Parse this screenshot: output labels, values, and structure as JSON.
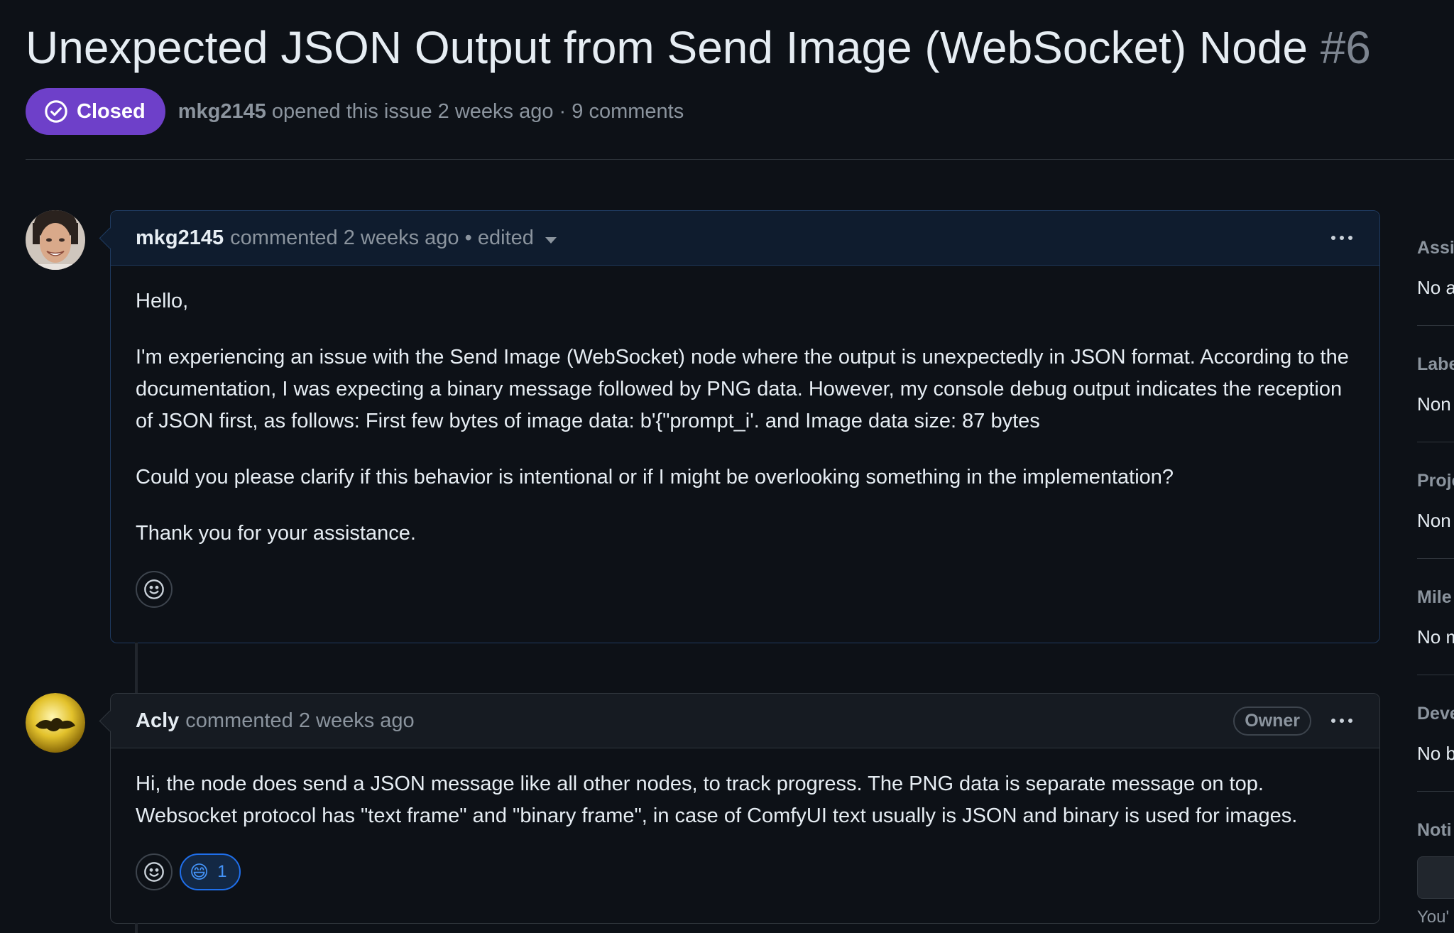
{
  "issue": {
    "title": "Unexpected JSON Output from Send Image (WebSocket) Node",
    "number": "#6",
    "state": "Closed",
    "state_color": "#6e40c9",
    "author": "mkg2145",
    "meta": "opened this issue 2 weeks ago · 9 comments"
  },
  "comments": [
    {
      "author": "mkg2145",
      "header_text": "commented 2 weeks ago • edited",
      "avatar": "user-photo",
      "paragraphs": [
        "Hello,",
        "I'm experiencing an issue with the Send Image (WebSocket) node where the output is unexpectedly in JSON format. According to the documentation, I was expecting a binary message followed by PNG data. However, my console debug output indicates the reception of JSON first, as follows: First few bytes of image data: b'{\"prompt_i'. and Image data size: 87 bytes",
        "Could you please clarify if this behavior is intentional or if I might be overlooking something in the implementation?",
        "Thank you for your assistance."
      ]
    },
    {
      "author": "Acly",
      "header_text": "commented 2 weeks ago",
      "badge": "Owner",
      "avatar": "gold-logo",
      "paragraphs": [
        "Hi, the node does send a JSON message like all other nodes, to track progress. The PNG data is separate message on top. Websocket protocol has \"text frame\" and \"binary frame\", in case of ComfyUI text usually is JSON and binary is used for images."
      ],
      "reactions": [
        {
          "emoji": "😄",
          "count": "1"
        }
      ]
    }
  ],
  "sidebar": {
    "sections": [
      {
        "heading": "Assi",
        "value": "No a"
      },
      {
        "heading": "Labe",
        "value": "Non"
      },
      {
        "heading": "Proje",
        "value": "Non"
      },
      {
        "heading": "Mile",
        "value": "No m"
      },
      {
        "heading": "Deve",
        "value": "No b"
      }
    ],
    "notifications_heading": "Noti",
    "notifications_foot": "You'"
  }
}
